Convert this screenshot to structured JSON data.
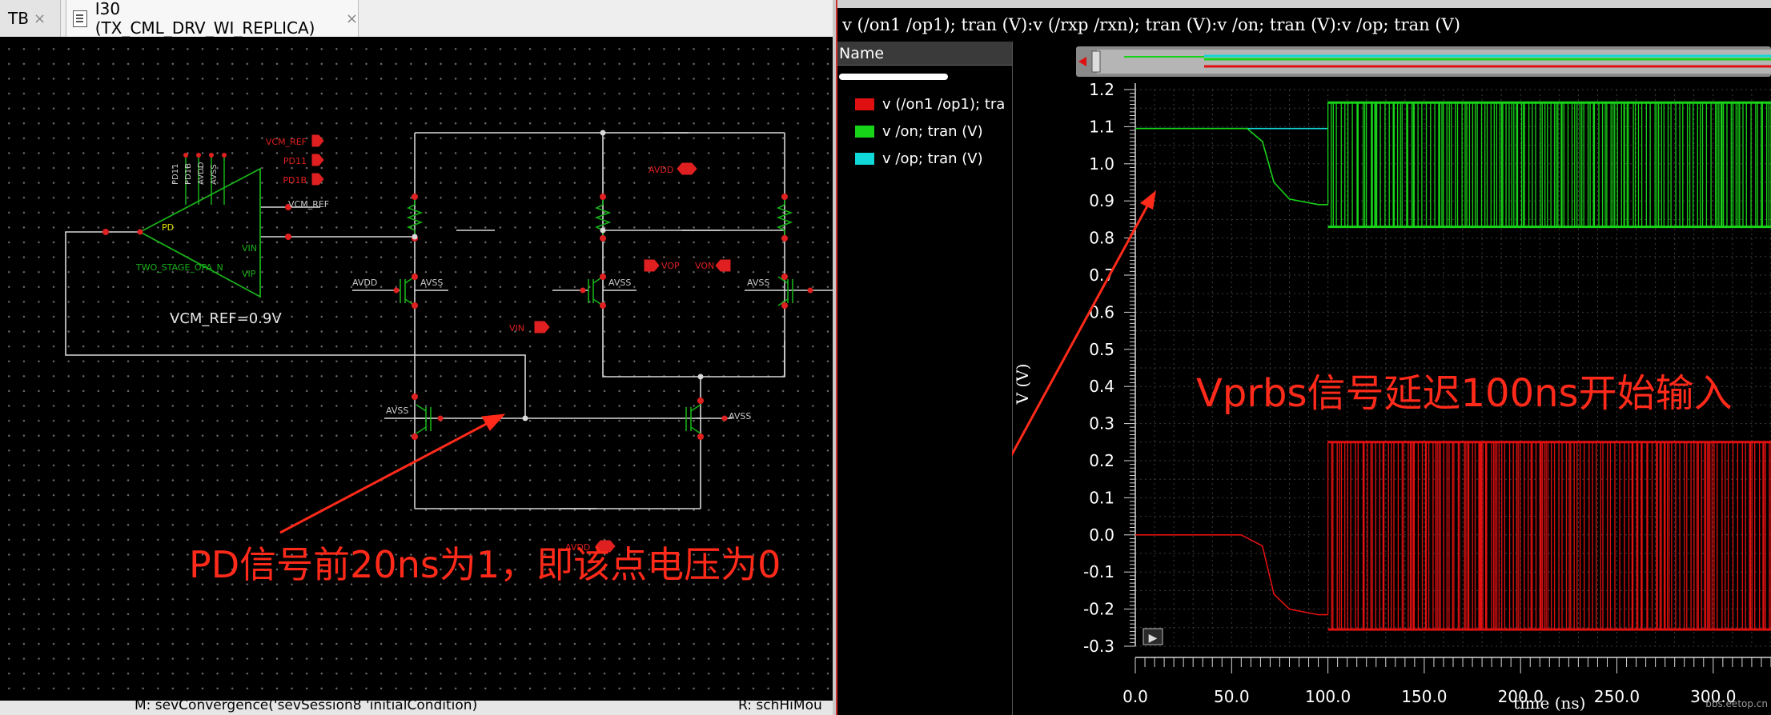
{
  "tabs": [
    {
      "label": "TB",
      "close": "×"
    },
    {
      "label": "I30 (TX_CML_DRV_WI_REPLICA)",
      "close": "×"
    }
  ],
  "schematic": {
    "opamp_label": "TWO_STAGE_OPA_N",
    "opamp_pins": [
      "PD11",
      "PD1B",
      "AVDD",
      "AVSS"
    ],
    "opamp_side_pins": [
      "VIN",
      "VIP"
    ],
    "pd_label": "PD",
    "pins_top": [
      "VCM_REF",
      "PD11",
      "PD1B"
    ],
    "net_vcm_ref": "VCM_REF",
    "note_vcm": "VCM_REF=0.9V",
    "labels": {
      "avdd_top": "AVDD",
      "avdd_bottom": "AVDD",
      "vop": "VOP",
      "von": "VON",
      "vin": "VIN",
      "avdd_left": "AVDD",
      "avss": "AVSS"
    },
    "annotation": "PD信号前20ns为1，即该点电压为0"
  },
  "left_status": {
    "left_text": "M: sevConvergence('sevSession8 'initialCondition)",
    "right_text": "R: schHiMou"
  },
  "waveform": {
    "title": "v (/on1 /op1); tran (V):v (/rxp /rxn); tran (V):v /on; tran (V):v /op; tran (V)",
    "name_header": "Name",
    "traces": [
      {
        "label": "v (/on1 /op1); tra",
        "color": "#e01010"
      },
      {
        "label": "v /on; tran (V)",
        "color": "#18d418"
      },
      {
        "label": "v /op; tran (V)",
        "color": "#10d8d8"
      }
    ],
    "annotation": "Vprbs信号延迟100ns开始输入",
    "watermark": "bbs.eetop.cn",
    "play_button": "▶"
  },
  "chart_data": {
    "type": "line",
    "xlabel": "time (ns)",
    "ylabel": "V (V)",
    "xlim": [
      0,
      330
    ],
    "ylim": [
      -0.3,
      1.2
    ],
    "x_ticks": [
      "0.0",
      "50.0",
      "100.0",
      "150.0",
      "200.0",
      "250.0",
      "300.0"
    ],
    "y_ticks": [
      "1.2",
      "1.1",
      "1.0",
      "0.9",
      "0.8",
      "0.7",
      "0.6",
      "0.5",
      "0.4",
      "0.3",
      "0.2",
      "0.1",
      "0.0",
      "-0.1",
      "-0.2",
      "-0.3"
    ],
    "grid": true,
    "series": [
      {
        "name": "v (/on1 /op1); tran (V)",
        "color": "#e01010",
        "initial": [
          [
            0,
            0.0
          ],
          [
            55,
            0.0
          ],
          [
            66,
            -0.03
          ],
          [
            72,
            -0.16
          ],
          [
            80,
            -0.2
          ],
          [
            95,
            -0.215
          ],
          [
            100,
            -0.215
          ]
        ],
        "toggle_from": 100,
        "toggle_high": 0.25,
        "toggle_low": -0.255
      },
      {
        "name": "v /on; tran (V)",
        "color": "#18d418",
        "initial": [
          [
            0,
            1.095
          ],
          [
            58,
            1.095
          ],
          [
            66,
            1.06
          ],
          [
            72,
            0.95
          ],
          [
            80,
            0.905
          ],
          [
            95,
            0.89
          ],
          [
            100,
            0.89
          ]
        ],
        "toggle_from": 100,
        "toggle_high": 1.165,
        "toggle_low": 0.83
      },
      {
        "name": "v /op; tran (V)",
        "color": "#10d8d8",
        "initial": [
          [
            0,
            1.095
          ],
          [
            100,
            1.095
          ]
        ],
        "toggle_from": 100,
        "toggle_high": 1.165,
        "toggle_low": 1.165
      }
    ]
  }
}
